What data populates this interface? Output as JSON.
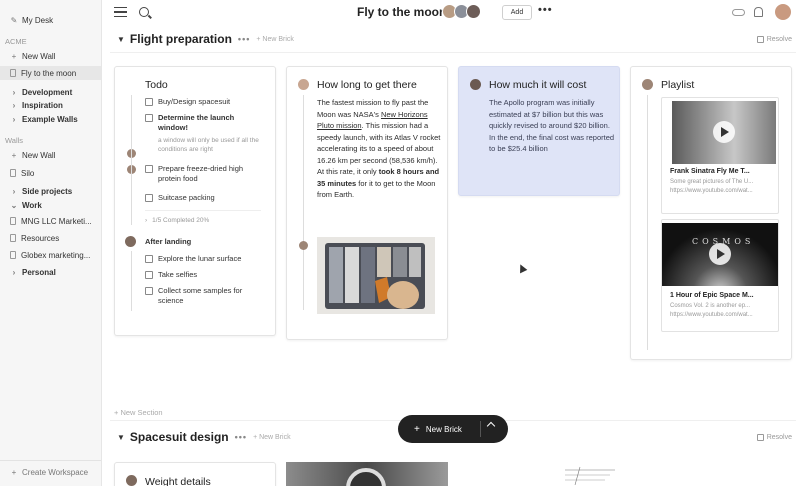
{
  "sidebar": {
    "my_desk": "My Desk",
    "workspace": "ACME",
    "new_wall_1": "New Wall",
    "fly_to_moon": "Fly to the moon",
    "development": "Development",
    "inspiration": "Inspiration",
    "example_walls": "Example Walls",
    "walls_head": "Walls",
    "new_wall_2": "New Wall",
    "silo": "Silo",
    "side_projects": "Side projects",
    "work": "Work",
    "mng": "MNG LLC Marketi...",
    "resources": "Resources",
    "globex": "Globex marketing...",
    "personal": "Personal",
    "create_workspace": "Create Workspace"
  },
  "header": {
    "title": "Fly to the moon",
    "add": "Add",
    "more": "•••"
  },
  "sections": {
    "flight": {
      "title": "Flight preparation",
      "dots": "•••",
      "new_brick": "+ New Brick",
      "resolve": "Resolve"
    },
    "new_section": "+ New Section",
    "spacesuit": {
      "title": "Spacesuit design",
      "dots": "•••",
      "new_brick": "+ New Brick",
      "resolve": "Resolve"
    }
  },
  "todo": {
    "title": "Todo",
    "items": [
      "Buy/Design spacesuit",
      "Determine the launch window!",
      "a window will only be used if all the conditions are right",
      "Prepare freeze-dried high protein food",
      "Suitcase packing"
    ],
    "completed": "1/5 Completed 20%",
    "after_landing": "After landing",
    "after_items": [
      "Explore the lunar surface",
      "Take selfies",
      "Collect some samples for science"
    ]
  },
  "long": {
    "title": "How long to get there",
    "p1": "The fastest mission to fly past the Moon was NASA's",
    "link": "New Horizons Pluto mission",
    "p2": ". This mission had a speedy launch, with its Atlas V rocket accelerating its to a speed of about 16.26 km per second (58,536 km/h). At this rate, it only",
    "bold": "took 8 hours and 35 minutes",
    "p3": "for it to get to the Moon from Earth."
  },
  "cost": {
    "title": "How much it will cost",
    "text": "The Apollo program was initially estimated at $7 billion but this was quickly revised to around $20 billion. In the end, the final cost was reported to be $25.4 billion"
  },
  "playlist": {
    "title": "Playlist",
    "videos": [
      {
        "title": "Frank Sinatra Fly Me T...",
        "sub": "Some great pictures of The U...",
        "url": "https://www.youtube.com/wat..."
      },
      {
        "title": "1 Hour of Epic Space M...",
        "sub": "Cosmos Vol. 2 is another ep...",
        "url": "https://www.youtube.com/wat..."
      }
    ],
    "cosmos_text": "COSMOS"
  },
  "spacesuit_card": {
    "title": "Weight details"
  },
  "fab": {
    "label": "New Brick"
  }
}
